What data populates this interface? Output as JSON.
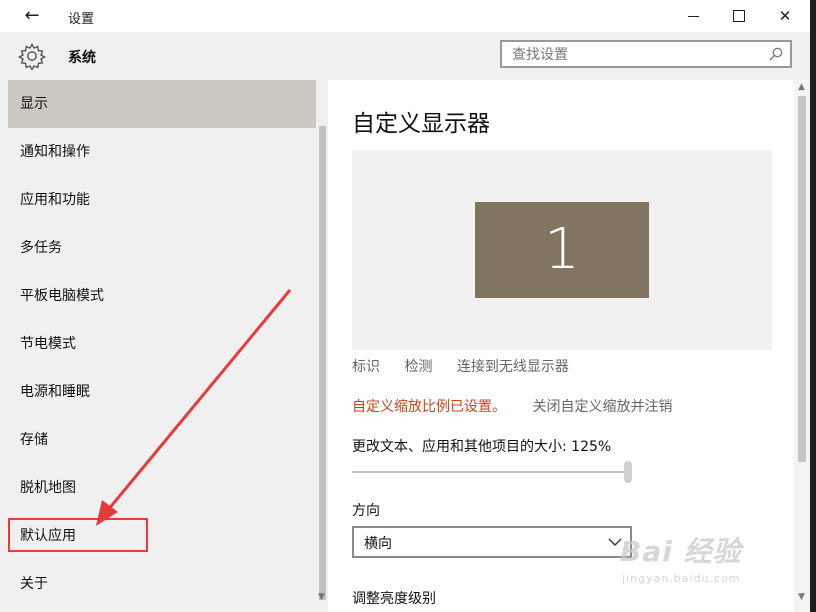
{
  "window": {
    "title": "设置",
    "back_glyph": "←",
    "close_glyph": "✕"
  },
  "header": {
    "section_title": "系统",
    "search_placeholder": "查找设置"
  },
  "sidebar": {
    "items": [
      {
        "label": "显示",
        "selected": true
      },
      {
        "label": "通知和操作"
      },
      {
        "label": "应用和功能"
      },
      {
        "label": "多任务"
      },
      {
        "label": "平板电脑模式"
      },
      {
        "label": "节电模式"
      },
      {
        "label": "电源和睡眠"
      },
      {
        "label": "存储"
      },
      {
        "label": "脱机地图"
      },
      {
        "label": "默认应用",
        "highlighted": true
      },
      {
        "label": "关于"
      }
    ]
  },
  "content": {
    "title": "自定义显示器",
    "monitor_number": "1",
    "links": [
      "标识",
      "检测",
      "连接到无线显示器"
    ],
    "scale_warning": "自定义缩放比例已设置。",
    "scale_link": "关闭自定义缩放并注销",
    "size_label": "更改文本、应用和其他项目的大小: 125%",
    "size_slider_value": 125,
    "orientation_label": "方向",
    "orientation_value": "横向",
    "brightness_label": "调整亮度级别"
  },
  "watermark": {
    "main": "Bai 经验",
    "sub": "jingyan.baidu.com"
  },
  "colors": {
    "selected_item": "#cdc8c2",
    "monitor": "#817561",
    "warning": "#c8451b",
    "annotation": "#e83a3a"
  }
}
